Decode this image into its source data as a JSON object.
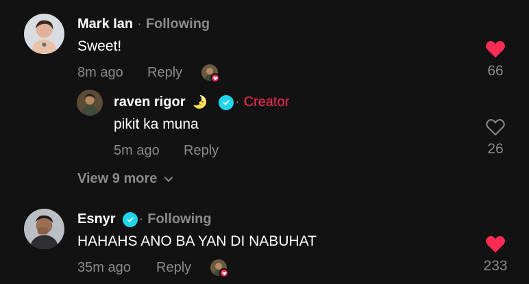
{
  "comments": [
    {
      "author": "Mark Ian",
      "separator": "·",
      "relation": "Following",
      "text": "Sweet!",
      "time": "8m ago",
      "reply_label": "Reply",
      "likes": "66",
      "liked": true,
      "avatar_icon": "user-photo-icon"
    },
    {
      "author": "Esnyr",
      "separator": "·",
      "relation": "Following",
      "text": "HAHAHS ANO BA YAN DI NABUHAT",
      "time": "35m ago",
      "reply_label": "Reply",
      "likes": "233",
      "liked": true,
      "avatar_icon": "user-photo-icon"
    }
  ],
  "reply": {
    "author": "raven rigor",
    "emoji": "🌛",
    "separator": "·",
    "badge": "Creator",
    "text": "pikit ka muna",
    "time": "5m ago",
    "reply_label": "Reply",
    "likes": "26",
    "liked": false
  },
  "view_more": "View 9 more",
  "colors": {
    "background": "#121212",
    "liked_heart": "#fe2c55",
    "creator": "#fe2c55",
    "verified": "#20d5ec",
    "muted": "#8a8a8a"
  }
}
